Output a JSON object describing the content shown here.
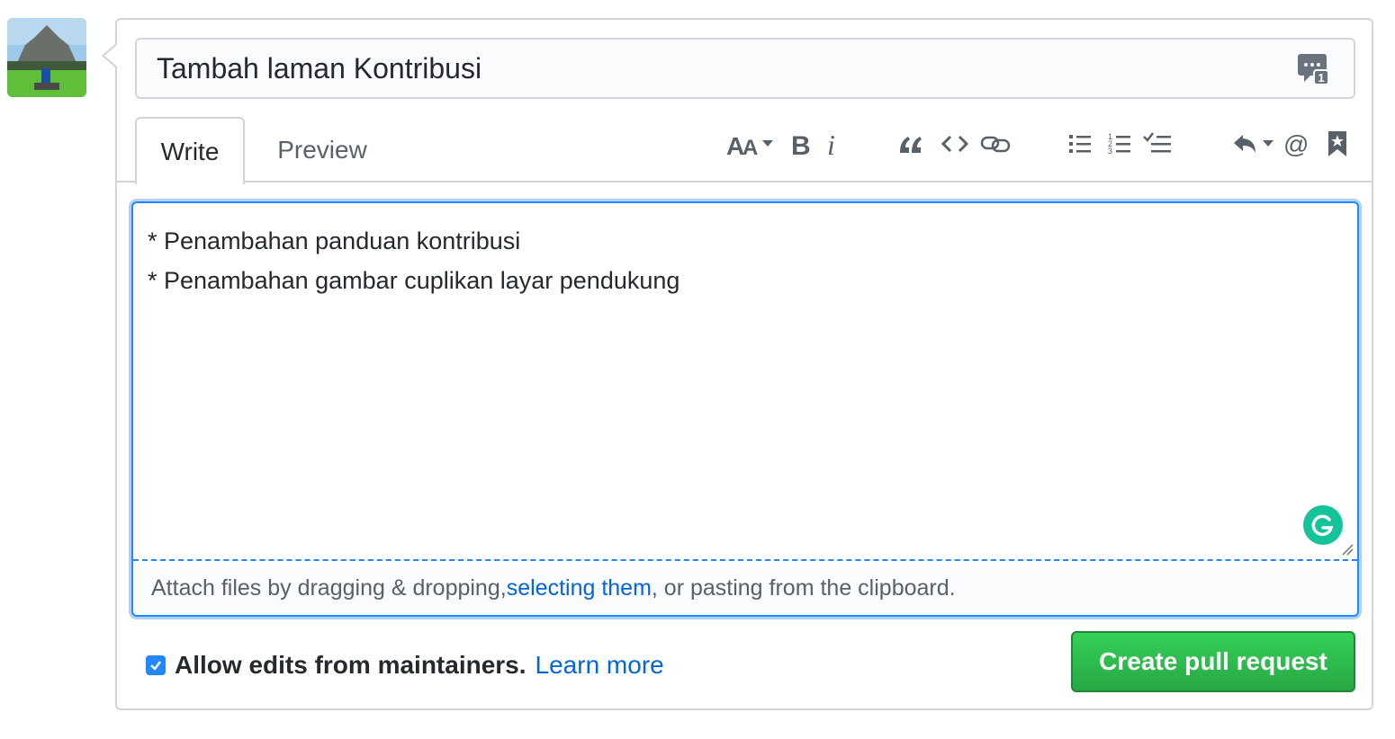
{
  "pr_title": "Tambah laman Kontribusi",
  "tabs": {
    "write": "Write",
    "preview": "Preview"
  },
  "toolbar": {
    "items": [
      "header-icon",
      "bold-icon",
      "italic-icon",
      "quote-icon",
      "code-icon",
      "link-icon",
      "unordered-list-icon",
      "ordered-list-icon",
      "task-list-icon",
      "reply-icon",
      "mention-icon",
      "bookmark-icon"
    ]
  },
  "body": {
    "text": "* Penambahan panduan kontribusi\n* Penambahan gambar cuplikan layar pendukung"
  },
  "attach": {
    "before": "Attach files by dragging & dropping, ",
    "link": "selecting them",
    "after": ", or pasting from the clipboard."
  },
  "footer": {
    "allow_edits_checked": true,
    "allow_edits_label": "Allow edits from maintainers.",
    "learn_more": "Learn more",
    "create_button": "Create pull request"
  },
  "colors": {
    "accent": "#2188ff",
    "link": "#0366d6",
    "primary_button": "#28a745",
    "grammarly": "#15c39a"
  }
}
